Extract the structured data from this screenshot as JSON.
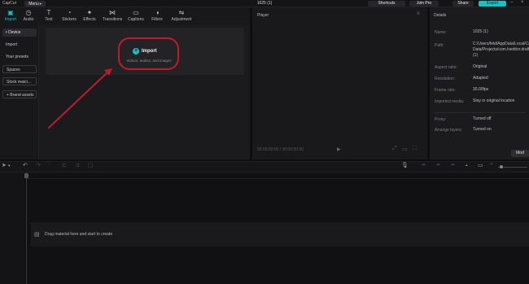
{
  "titlebar": {
    "logo": "CapCut",
    "menu_label": "Menu",
    "project_title": "1025 (1)",
    "shortcuts_label": "Shortcuts",
    "joinpro_label": "Join Pro",
    "share_label": "Share",
    "export_label": "Export"
  },
  "toolbar": {
    "tabs": [
      {
        "label": "Import",
        "icon": "import-icon"
      },
      {
        "label": "Audio",
        "icon": "audio-icon"
      },
      {
        "label": "Text",
        "icon": "text-icon"
      },
      {
        "label": "Stickers",
        "icon": "stickers-icon"
      },
      {
        "label": "Effects",
        "icon": "effects-icon"
      },
      {
        "label": "Transitions",
        "icon": "transitions-icon"
      },
      {
        "label": "Captions",
        "icon": "captions-icon"
      },
      {
        "label": "Filters",
        "icon": "filters-icon"
      },
      {
        "label": "Adjustment",
        "icon": "adjustment-icon"
      }
    ]
  },
  "sidebar": {
    "items": [
      {
        "label": "• Device"
      },
      {
        "label": "Import"
      },
      {
        "label": "Your presets"
      },
      {
        "label": "Spaces"
      },
      {
        "label": "Stock matci..."
      },
      {
        "label": "+ Brand assets"
      }
    ]
  },
  "media": {
    "import_label": "Import",
    "import_sub": "Videos, audios, and images"
  },
  "player": {
    "title": "Player",
    "time": "00:00:00:00 / 00:00:00:00"
  },
  "details": {
    "title": "Details",
    "rows": [
      {
        "key": "Name:",
        "value": "1025 (1)"
      },
      {
        "key": "Path:",
        "value": "C:/Users/feld/AppData/Local/CapCut/User Data/Projects/com.lveditor.draft/1025 (1)"
      },
      {
        "key": "Aspect ratio:",
        "value": "Original"
      },
      {
        "key": "Resolution:",
        "value": "Adapted"
      },
      {
        "key": "Frame rate:",
        "value": "30.00fps"
      },
      {
        "key": "Imported media:",
        "value": "Stay in original location"
      },
      {
        "key": "Proxy:",
        "value": "Turned off"
      },
      {
        "key": "Arrange layers:",
        "value": "Turned on"
      }
    ],
    "modify_label": "Mod"
  },
  "timeline": {
    "drop_text": "Drag material here and start to create"
  },
  "colors": {
    "accent": "#14c2c8",
    "annotation": "#c21a2b"
  }
}
